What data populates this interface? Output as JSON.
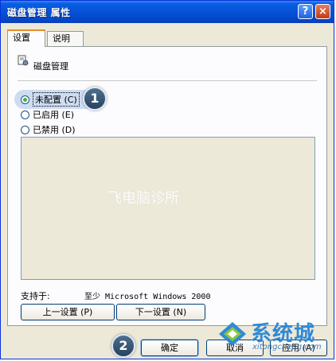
{
  "window": {
    "title": "磁盘管理 属性",
    "help_label": "?",
    "close_label": "×"
  },
  "tabs": [
    {
      "label": "设置",
      "active": true
    },
    {
      "label": "说明",
      "active": false
    }
  ],
  "policy": {
    "name": "磁盘管理"
  },
  "options": [
    {
      "label": "未配置 (C)",
      "checked": true
    },
    {
      "label": "已启用 (E)",
      "checked": false
    },
    {
      "label": "已禁用 (D)",
      "checked": false
    }
  ],
  "comment_watermark": "飞电脑诊所",
  "supported": {
    "label": "支持于:",
    "value": "至少 Microsoft Windows 2000"
  },
  "nav_buttons": {
    "prev": "上一设置 (P)",
    "next": "下一设置 (N)"
  },
  "dialog_buttons": {
    "ok": "确定",
    "cancel": "取消",
    "apply": "应用 (A)"
  },
  "annotations": {
    "step1": "1",
    "step2": "2"
  },
  "brand": {
    "name": "系统城",
    "url": "xitongcheng.com"
  },
  "colors": {
    "title_bar": "#0553d8",
    "dialog_bg": "#ece9d8",
    "radio_selected": "#3fb33f",
    "brand_blue": "#2f8ad6"
  }
}
